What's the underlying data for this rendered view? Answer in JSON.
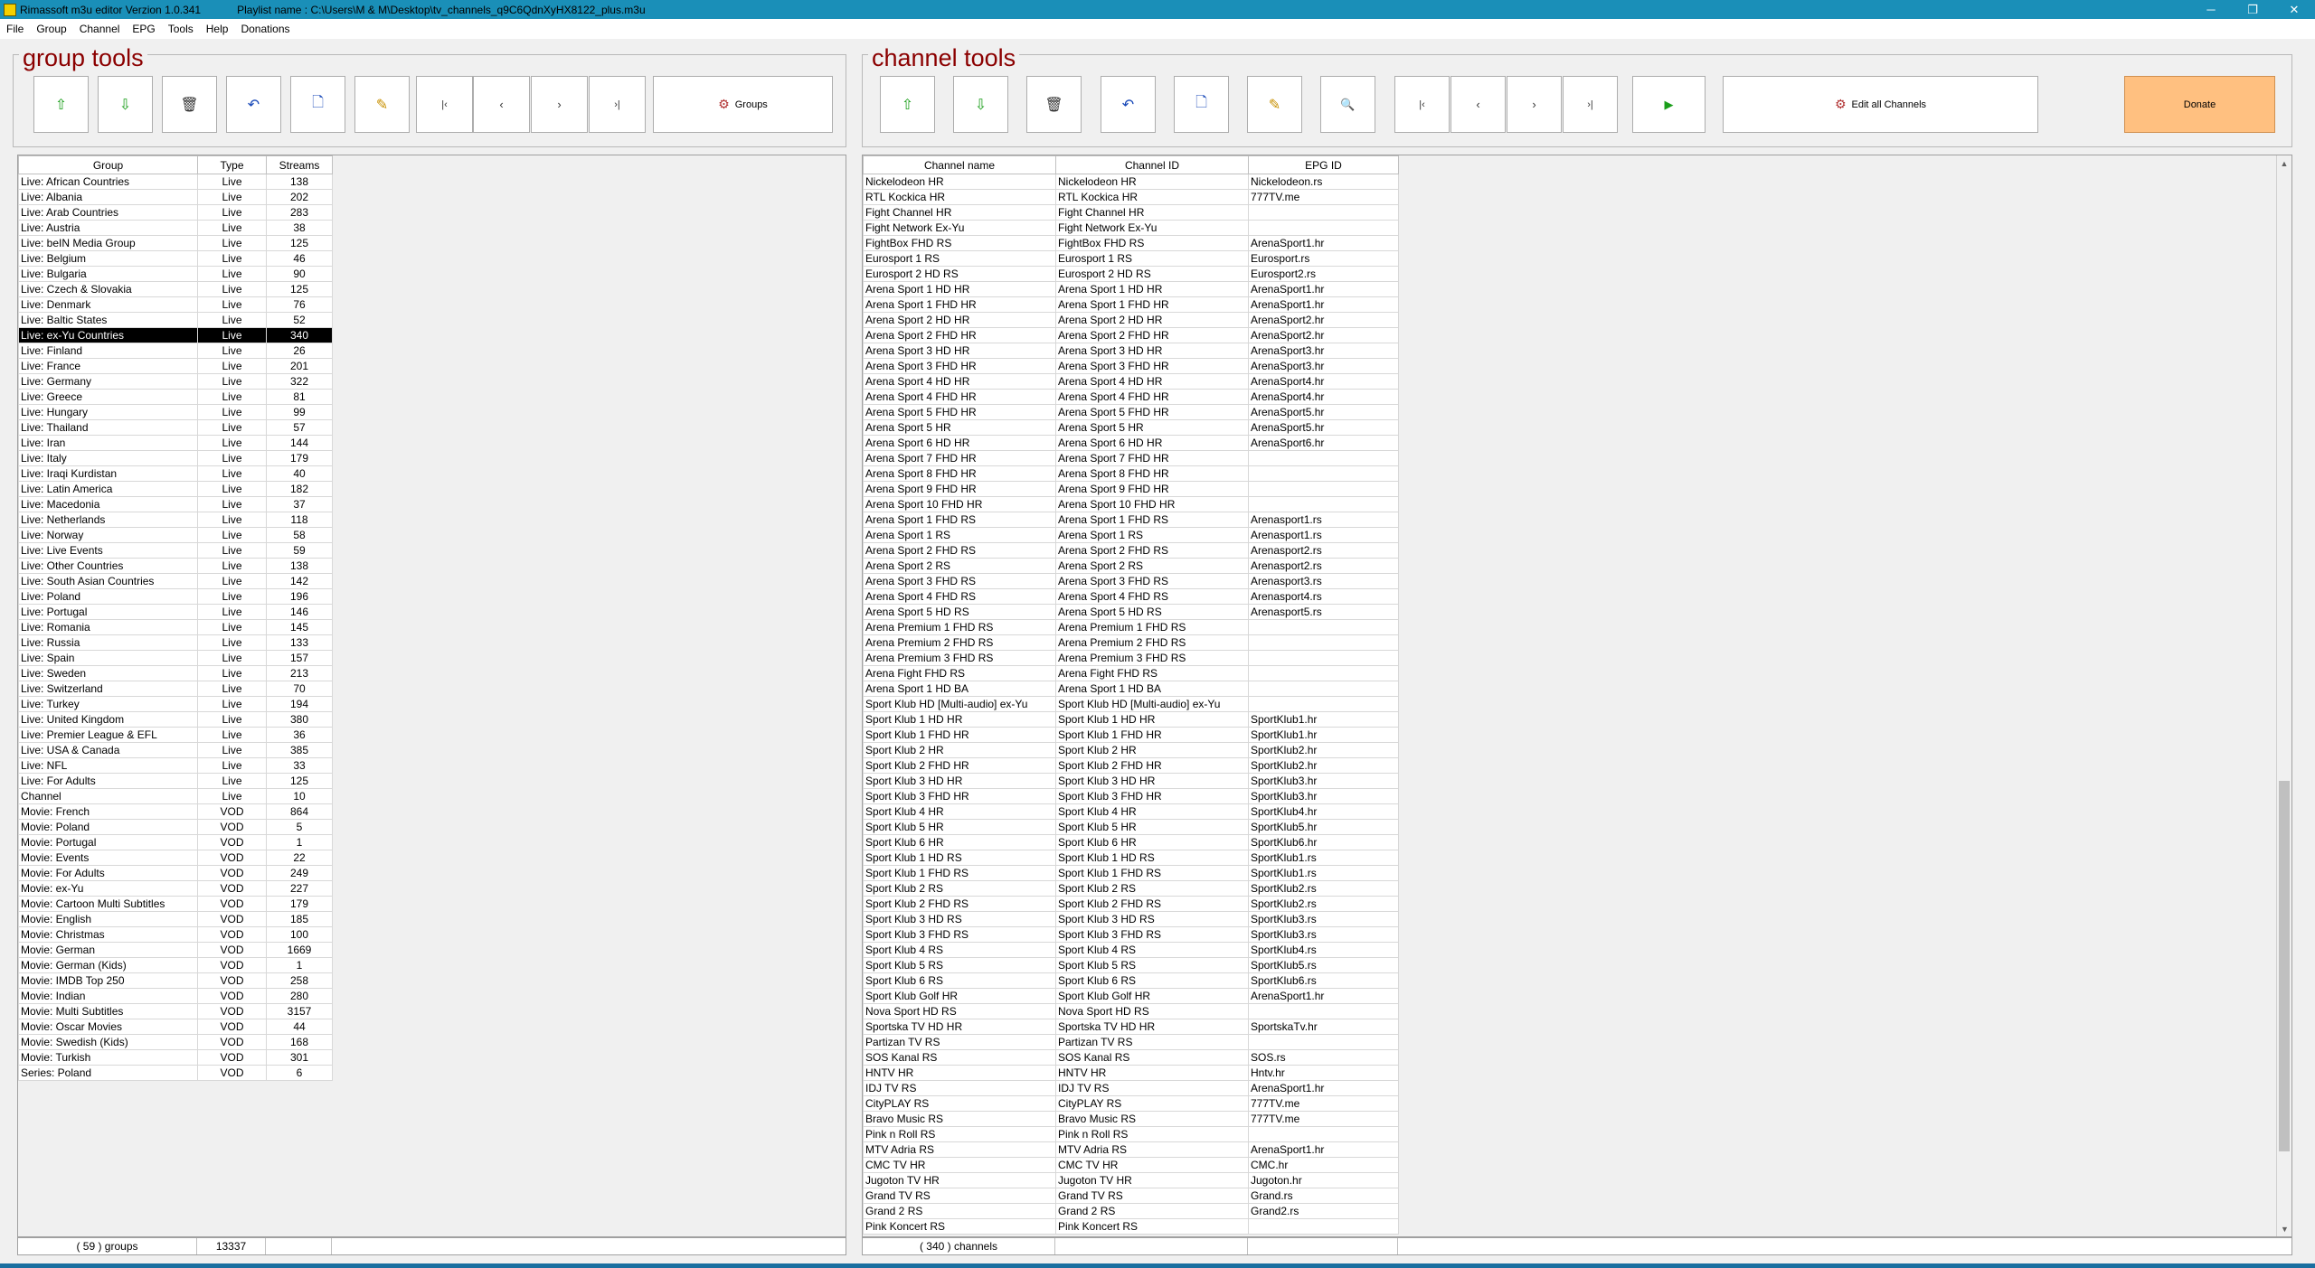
{
  "window": {
    "title": "Rimassoft  m3u editor  Verzion 1.0.341",
    "playlist": "Playlist name :  C:\\Users\\M & M\\Desktop\\tv_channels_q9C6QdnXyHX8122_plus.m3u",
    "minimize": "─",
    "restore": "❐",
    "close": "✕"
  },
  "menu": [
    "File",
    "Group",
    "Channel",
    "EPG",
    "Tools",
    "Help",
    "Donations"
  ],
  "group_tools": {
    "title": "group tools",
    "groups_button": "Groups",
    "columns": [
      "Group",
      "Type",
      "Streams"
    ],
    "selected_index": 10,
    "rows": [
      [
        "Live: African Countries",
        "Live",
        "138"
      ],
      [
        "Live: Albania",
        "Live",
        "202"
      ],
      [
        "Live: Arab Countries",
        "Live",
        "283"
      ],
      [
        "Live: Austria",
        "Live",
        "38"
      ],
      [
        "Live: beIN Media Group",
        "Live",
        "125"
      ],
      [
        "Live: Belgium",
        "Live",
        "46"
      ],
      [
        "Live: Bulgaria",
        "Live",
        "90"
      ],
      [
        "Live: Czech & Slovakia",
        "Live",
        "125"
      ],
      [
        "Live: Denmark",
        "Live",
        "76"
      ],
      [
        "Live: Baltic States",
        "Live",
        "52"
      ],
      [
        "Live: ex-Yu Countries",
        "Live",
        "340"
      ],
      [
        "Live: Finland",
        "Live",
        "26"
      ],
      [
        "Live: France",
        "Live",
        "201"
      ],
      [
        "Live: Germany",
        "Live",
        "322"
      ],
      [
        "Live: Greece",
        "Live",
        "81"
      ],
      [
        "Live: Hungary",
        "Live",
        "99"
      ],
      [
        "Live: Thailand",
        "Live",
        "57"
      ],
      [
        "Live: Iran",
        "Live",
        "144"
      ],
      [
        "Live: Italy",
        "Live",
        "179"
      ],
      [
        "Live: Iraqi Kurdistan",
        "Live",
        "40"
      ],
      [
        "Live: Latin America",
        "Live",
        "182"
      ],
      [
        "Live: Macedonia",
        "Live",
        "37"
      ],
      [
        "Live: Netherlands",
        "Live",
        "118"
      ],
      [
        "Live: Norway",
        "Live",
        "58"
      ],
      [
        "Live: Live Events",
        "Live",
        "59"
      ],
      [
        "Live: Other Countries",
        "Live",
        "138"
      ],
      [
        "Live: South Asian Countries",
        "Live",
        "142"
      ],
      [
        "Live: Poland",
        "Live",
        "196"
      ],
      [
        "Live: Portugal",
        "Live",
        "146"
      ],
      [
        "Live: Romania",
        "Live",
        "145"
      ],
      [
        "Live: Russia",
        "Live",
        "133"
      ],
      [
        "Live: Spain",
        "Live",
        "157"
      ],
      [
        "Live: Sweden",
        "Live",
        "213"
      ],
      [
        "Live: Switzerland",
        "Live",
        "70"
      ],
      [
        "Live: Turkey",
        "Live",
        "194"
      ],
      [
        "Live: United Kingdom",
        "Live",
        "380"
      ],
      [
        "Live: Premier League & EFL",
        "Live",
        "36"
      ],
      [
        "Live: USA & Canada",
        "Live",
        "385"
      ],
      [
        "Live: NFL",
        "Live",
        "33"
      ],
      [
        "Live: For Adults",
        "Live",
        "125"
      ],
      [
        "Channel",
        "Live",
        "10"
      ],
      [
        "Movie: French",
        "VOD",
        "864"
      ],
      [
        "Movie: Poland",
        "VOD",
        "5"
      ],
      [
        "Movie: Portugal",
        "VOD",
        "1"
      ],
      [
        "Movie: Events",
        "VOD",
        "22"
      ],
      [
        "Movie: For Adults",
        "VOD",
        "249"
      ],
      [
        "Movie: ex-Yu",
        "VOD",
        "227"
      ],
      [
        "Movie: Cartoon Multi Subtitles",
        "VOD",
        "179"
      ],
      [
        "Movie: English",
        "VOD",
        "185"
      ],
      [
        "Movie: Christmas",
        "VOD",
        "100"
      ],
      [
        "Movie: German",
        "VOD",
        "1669"
      ],
      [
        "Movie: German (Kids)",
        "VOD",
        "1"
      ],
      [
        "Movie: IMDB Top 250",
        "VOD",
        "258"
      ],
      [
        "Movie: Indian",
        "VOD",
        "280"
      ],
      [
        "Movie: Multi Subtitles",
        "VOD",
        "3157"
      ],
      [
        "Movie: Oscar Movies",
        "VOD",
        "44"
      ],
      [
        "Movie: Swedish (Kids)",
        "VOD",
        "168"
      ],
      [
        "Movie: Turkish",
        "VOD",
        "301"
      ],
      [
        "Series: Poland",
        "VOD",
        "6"
      ]
    ],
    "footer_count": "( 59 )  groups",
    "footer_total": "13337"
  },
  "channel_tools": {
    "title": "channel tools",
    "edit_all_button": "Edit all Channels",
    "donate_button": "Donate",
    "columns": [
      "Channel name",
      "Channel ID",
      "EPG ID"
    ],
    "rows": [
      [
        "Nickelodeon HR",
        "Nickelodeon HR",
        "Nickelodeon.rs"
      ],
      [
        "RTL Kockica HR",
        "RTL Kockica HR",
        "777TV.me"
      ],
      [
        "Fight Channel HR",
        "Fight Channel HR",
        ""
      ],
      [
        "Fight Network Ex-Yu",
        "Fight Network Ex-Yu",
        ""
      ],
      [
        "FightBox FHD RS",
        "FightBox FHD RS",
        "ArenaSport1.hr"
      ],
      [
        "Eurosport 1 RS",
        "Eurosport 1 RS",
        "Eurosport.rs"
      ],
      [
        "Eurosport 2 HD RS",
        "Eurosport 2 HD RS",
        "Eurosport2.rs"
      ],
      [
        "Arena Sport 1 HD HR",
        "Arena Sport 1 HD HR",
        "ArenaSport1.hr"
      ],
      [
        "Arena Sport 1 FHD HR",
        "Arena Sport 1 FHD HR",
        "ArenaSport1.hr"
      ],
      [
        "Arena Sport 2 HD HR",
        "Arena Sport 2 HD HR",
        "ArenaSport2.hr"
      ],
      [
        "Arena Sport 2 FHD HR",
        "Arena Sport 2 FHD HR",
        "ArenaSport2.hr"
      ],
      [
        "Arena Sport 3 HD HR",
        "Arena Sport 3 HD HR",
        "ArenaSport3.hr"
      ],
      [
        "Arena Sport 3 FHD HR",
        "Arena Sport 3 FHD HR",
        "ArenaSport3.hr"
      ],
      [
        "Arena Sport 4 HD HR",
        "Arena Sport 4 HD HR",
        "ArenaSport4.hr"
      ],
      [
        "Arena Sport 4 FHD HR",
        "Arena Sport 4 FHD HR",
        "ArenaSport4.hr"
      ],
      [
        "Arena Sport 5 FHD HR",
        "Arena Sport 5 FHD HR",
        "ArenaSport5.hr"
      ],
      [
        "Arena Sport 5 HR",
        "Arena Sport 5 HR",
        "ArenaSport5.hr"
      ],
      [
        "Arena Sport 6 HD HR",
        "Arena Sport 6 HD HR",
        "ArenaSport6.hr"
      ],
      [
        "Arena Sport 7 FHD HR",
        "Arena Sport 7 FHD HR",
        ""
      ],
      [
        "Arena Sport 8 FHD HR",
        "Arena Sport 8 FHD HR",
        ""
      ],
      [
        "Arena Sport 9 FHD HR",
        "Arena Sport 9 FHD HR",
        ""
      ],
      [
        "Arena Sport 10 FHD HR",
        "Arena Sport 10 FHD HR",
        ""
      ],
      [
        "Arena Sport 1 FHD RS",
        "Arena Sport 1 FHD RS",
        "Arenasport1.rs"
      ],
      [
        "Arena Sport 1 RS",
        "Arena Sport 1 RS",
        "Arenasport1.rs"
      ],
      [
        "Arena Sport 2 FHD RS",
        "Arena Sport 2 FHD RS",
        "Arenasport2.rs"
      ],
      [
        "Arena Sport 2 RS",
        "Arena Sport 2 RS",
        "Arenasport2.rs"
      ],
      [
        "Arena Sport 3 FHD RS",
        "Arena Sport 3 FHD RS",
        "Arenasport3.rs"
      ],
      [
        "Arena Sport 4 FHD RS",
        "Arena Sport 4 FHD RS",
        "Arenasport4.rs"
      ],
      [
        "Arena Sport 5 HD RS",
        "Arena Sport 5 HD RS",
        "Arenasport5.rs"
      ],
      [
        "Arena Premium 1 FHD RS",
        "Arena Premium 1 FHD RS",
        ""
      ],
      [
        "Arena Premium 2 FHD RS",
        "Arena Premium 2 FHD RS",
        ""
      ],
      [
        "Arena Premium 3 FHD RS",
        "Arena Premium 3 FHD RS",
        ""
      ],
      [
        "Arena Fight FHD RS",
        "Arena Fight FHD RS",
        ""
      ],
      [
        "Arena Sport 1 HD BA",
        "Arena Sport 1 HD BA",
        ""
      ],
      [
        "Sport Klub HD [Multi-audio] ex-Yu",
        "Sport Klub HD [Multi-audio] ex-Yu",
        ""
      ],
      [
        "Sport Klub 1 HD HR",
        "Sport Klub 1 HD HR",
        "SportKlub1.hr"
      ],
      [
        "Sport Klub 1 FHD HR",
        "Sport Klub 1 FHD HR",
        "SportKlub1.hr"
      ],
      [
        "Sport Klub 2 HR",
        "Sport Klub 2 HR",
        "SportKlub2.hr"
      ],
      [
        "Sport Klub 2 FHD HR",
        "Sport Klub 2 FHD HR",
        "SportKlub2.hr"
      ],
      [
        "Sport Klub 3 HD HR",
        "Sport Klub 3 HD HR",
        "SportKlub3.hr"
      ],
      [
        "Sport Klub 3 FHD HR",
        "Sport Klub 3 FHD HR",
        "SportKlub3.hr"
      ],
      [
        "Sport Klub 4 HR",
        "Sport Klub 4 HR",
        "SportKlub4.hr"
      ],
      [
        "Sport Klub 5 HR",
        "Sport Klub 5 HR",
        "SportKlub5.hr"
      ],
      [
        "Sport Klub 6 HR",
        "Sport Klub 6 HR",
        "SportKlub6.hr"
      ],
      [
        "Sport Klub 1 HD RS",
        "Sport Klub 1 HD RS",
        "SportKlub1.rs"
      ],
      [
        "Sport Klub 1 FHD RS",
        "Sport Klub 1 FHD RS",
        "SportKlub1.rs"
      ],
      [
        "Sport Klub 2 RS",
        "Sport Klub 2 RS",
        "SportKlub2.rs"
      ],
      [
        "Sport Klub 2 FHD RS",
        "Sport Klub 2 FHD RS",
        "SportKlub2.rs"
      ],
      [
        "Sport Klub 3 HD RS",
        "Sport Klub 3 HD RS",
        "SportKlub3.rs"
      ],
      [
        "Sport Klub 3 FHD RS",
        "Sport Klub 3 FHD RS",
        "SportKlub3.rs"
      ],
      [
        "Sport Klub 4 RS",
        "Sport Klub 4 RS",
        "SportKlub4.rs"
      ],
      [
        "Sport Klub 5 RS",
        "Sport Klub 5 RS",
        "SportKlub5.rs"
      ],
      [
        "Sport Klub 6 RS",
        "Sport Klub 6 RS",
        "SportKlub6.rs"
      ],
      [
        "Sport Klub Golf HR",
        "Sport Klub Golf HR",
        "ArenaSport1.hr"
      ],
      [
        "Nova Sport HD RS",
        "Nova Sport HD RS",
        ""
      ],
      [
        "Sportska TV HD HR",
        "Sportska TV HD HR",
        "SportskaTv.hr"
      ],
      [
        "Partizan TV RS",
        "Partizan TV RS",
        ""
      ],
      [
        "SOS Kanal RS",
        "SOS Kanal RS",
        "SOS.rs"
      ],
      [
        "HNTV HR",
        "HNTV HR",
        "Hntv.hr"
      ],
      [
        "IDJ TV RS",
        "IDJ TV RS",
        "ArenaSport1.hr"
      ],
      [
        "CityPLAY RS",
        "CityPLAY RS",
        "777TV.me"
      ],
      [
        "Bravo Music RS",
        "Bravo Music RS",
        "777TV.me"
      ],
      [
        "Pink n Roll RS",
        "Pink n Roll RS",
        ""
      ],
      [
        "MTV Adria RS",
        "MTV Adria RS",
        "ArenaSport1.hr"
      ],
      [
        "CMC TV HR",
        "CMC TV HR",
        "CMC.hr"
      ],
      [
        "Jugoton TV HR",
        "Jugoton TV HR",
        "Jugoton.hr"
      ],
      [
        "Grand TV RS",
        "Grand TV RS",
        "Grand.rs"
      ],
      [
        "Grand 2 RS",
        "Grand 2 RS",
        "Grand2.rs"
      ],
      [
        "Pink Koncert RS",
        "Pink Koncert RS",
        ""
      ]
    ],
    "footer_count": "( 340 )  channels"
  },
  "icons": {
    "up": "⇧",
    "down": "⇩",
    "delete": "🗑",
    "undo": "↶",
    "new": "🗋",
    "edit": "✎",
    "first": "|‹",
    "prev": "‹",
    "next": "›",
    "last": "›|",
    "search": "🔍",
    "play": "▶",
    "groups": "⚙",
    "scroll_up": "▲",
    "scroll_down": "▼"
  },
  "colors": {
    "titlebar": "#1a8fb8",
    "section_title": "#8b0000",
    "selection": "#000000",
    "donate": "#ffc080"
  }
}
